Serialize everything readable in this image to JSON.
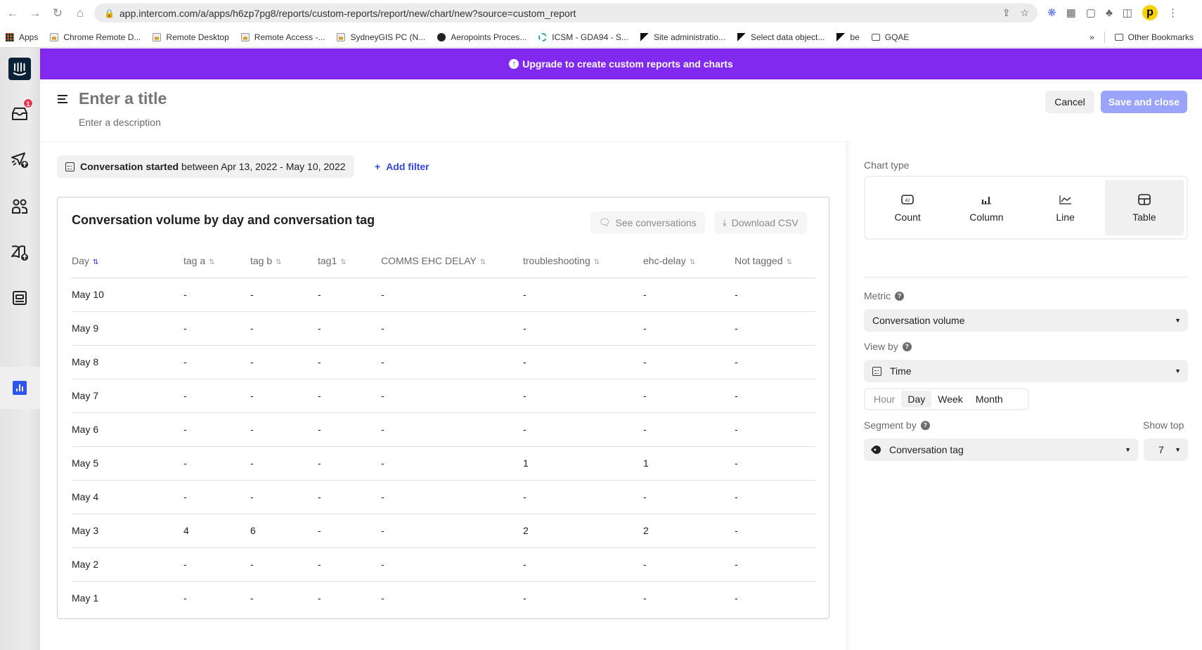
{
  "browser": {
    "url_domain": "app.intercom.com",
    "url_path": "/a/apps/h6zp7pg8/reports/custom-reports/report/new/chart/new?source=custom_report",
    "bookmarks": [
      {
        "label": "Apps",
        "icon": "apps-grid-icon"
      },
      {
        "label": "Chrome Remote D...",
        "icon": "remote-desktop-icon"
      },
      {
        "label": "Remote Desktop",
        "icon": "remote-desktop-icon"
      },
      {
        "label": "Remote Access -...",
        "icon": "remote-desktop-icon"
      },
      {
        "label": "SydneyGIS PC (N...",
        "icon": "remote-desktop-icon"
      },
      {
        "label": "Aeropoints Proces...",
        "icon": "globe-icon"
      },
      {
        "label": "ICSM - GDA94 - S...",
        "icon": "ring-icon"
      },
      {
        "label": "Site administratio...",
        "icon": "moodle-icon"
      },
      {
        "label": "Select data object...",
        "icon": "moodle-icon"
      },
      {
        "label": "be",
        "icon": "moodle-icon"
      },
      {
        "label": "GQAE",
        "icon": "folder-icon"
      }
    ],
    "overflow_label": "»",
    "other_bookmarks": "Other Bookmarks",
    "profile_letter": "p"
  },
  "nav": {
    "inbox_badge": "1"
  },
  "banner": {
    "text": "Upgrade to create custom reports and charts",
    "color": "#8129ee"
  },
  "header": {
    "title_placeholder": "Enter a title",
    "description_placeholder": "Enter a description",
    "cancel_label": "Cancel",
    "save_label": "Save and close"
  },
  "filter": {
    "field": "Conversation started",
    "condition": "between Apr 13, 2022 - May 10, 2022",
    "add_filter_label": "Add filter"
  },
  "report": {
    "title": "Conversation volume by day and conversation tag",
    "see_conversations_label": "See conversations",
    "download_csv_label": "Download CSV",
    "columns": [
      "Day",
      "tag a",
      "tag b",
      "tag1",
      "COMMS EHC DELAY",
      "troubleshooting",
      "ehc-delay",
      "Not tagged"
    ],
    "rows": [
      [
        "May 10",
        "-",
        "-",
        "-",
        "-",
        "-",
        "-",
        "-"
      ],
      [
        "May 9",
        "-",
        "-",
        "-",
        "-",
        "-",
        "-",
        "-"
      ],
      [
        "May 8",
        "-",
        "-",
        "-",
        "-",
        "-",
        "-",
        "-"
      ],
      [
        "May 7",
        "-",
        "-",
        "-",
        "-",
        "-",
        "-",
        "-"
      ],
      [
        "May 6",
        "-",
        "-",
        "-",
        "-",
        "-",
        "-",
        "-"
      ],
      [
        "May 5",
        "-",
        "-",
        "-",
        "-",
        "1",
        "1",
        "-"
      ],
      [
        "May 4",
        "-",
        "-",
        "-",
        "-",
        "-",
        "-",
        "-"
      ],
      [
        "May 3",
        "4",
        "6",
        "-",
        "-",
        "2",
        "2",
        "-"
      ],
      [
        "May 2",
        "-",
        "-",
        "-",
        "-",
        "-",
        "-",
        "-"
      ],
      [
        "May 1",
        "-",
        "-",
        "-",
        "-",
        "-",
        "-",
        "-"
      ]
    ]
  },
  "settings": {
    "chart_type_label": "Chart type",
    "chart_types": [
      {
        "label": "Count",
        "icon": "count-icon",
        "selected": false
      },
      {
        "label": "Column",
        "icon": "column-chart-icon",
        "selected": false
      },
      {
        "label": "Line",
        "icon": "line-chart-icon",
        "selected": false
      },
      {
        "label": "Table",
        "icon": "table-icon",
        "selected": true
      }
    ],
    "metric_label": "Metric",
    "metric_value": "Conversation volume",
    "view_by_label": "View by",
    "view_by_value": "Time",
    "granularity": [
      {
        "label": "Hour",
        "state": "disabled"
      },
      {
        "label": "Day",
        "state": "active"
      },
      {
        "label": "Week",
        "state": "normal"
      },
      {
        "label": "Month",
        "state": "normal"
      }
    ],
    "segment_by_label": "Segment by",
    "segment_by_value": "Conversation tag",
    "show_top_label": "Show top",
    "show_top_value": "7"
  }
}
